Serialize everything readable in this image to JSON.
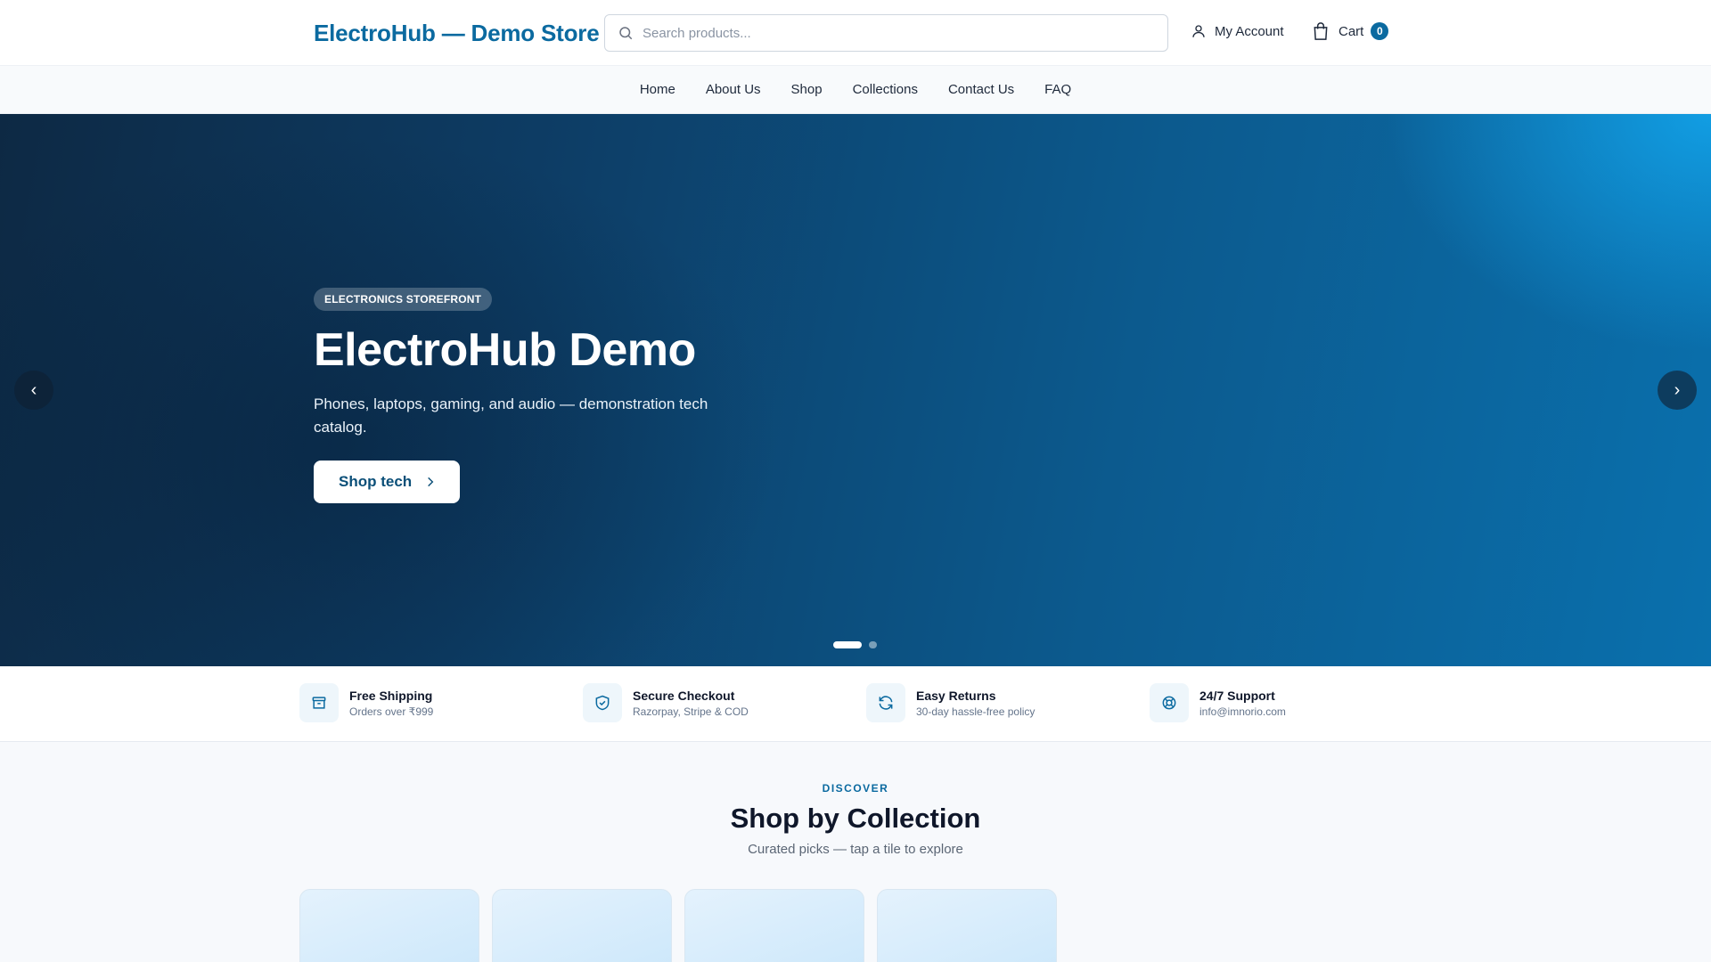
{
  "header": {
    "brand": "ElectroHub — Demo Store",
    "search_placeholder": "Search products...",
    "account_label": "My Account",
    "cart_label": "Cart",
    "cart_count": "0"
  },
  "nav": {
    "items": [
      "Home",
      "About Us",
      "Shop",
      "Collections",
      "Contact Us",
      "FAQ"
    ]
  },
  "hero": {
    "badge": "ELECTRONICS STOREFRONT",
    "title": "ElectroHub Demo",
    "subtitle": "Phones, laptops, gaming, and audio — demonstration tech catalog.",
    "cta": "Shop tech",
    "prev_glyph": "‹",
    "next_glyph": "›",
    "slides": 2,
    "active_slide": 1
  },
  "features": [
    {
      "title": "Free Shipping",
      "subtitle": "Orders over ₹999",
      "icon": "box-icon"
    },
    {
      "title": "Secure Checkout",
      "subtitle": "Razorpay, Stripe & COD",
      "icon": "shield-icon"
    },
    {
      "title": "Easy Returns",
      "subtitle": "30-day hassle-free policy",
      "icon": "refresh-icon"
    },
    {
      "title": "24/7 Support",
      "subtitle": "info@imnorio.com",
      "icon": "lifebuoy-icon"
    }
  ],
  "collections": {
    "eyebrow": "DISCOVER",
    "title": "Shop by Collection",
    "subtitle": "Curated picks — tap a tile to explore"
  },
  "colors": {
    "brand": "#0b6aa0",
    "hero_dark": "#0d2944",
    "hero_light": "#12a0e6"
  }
}
